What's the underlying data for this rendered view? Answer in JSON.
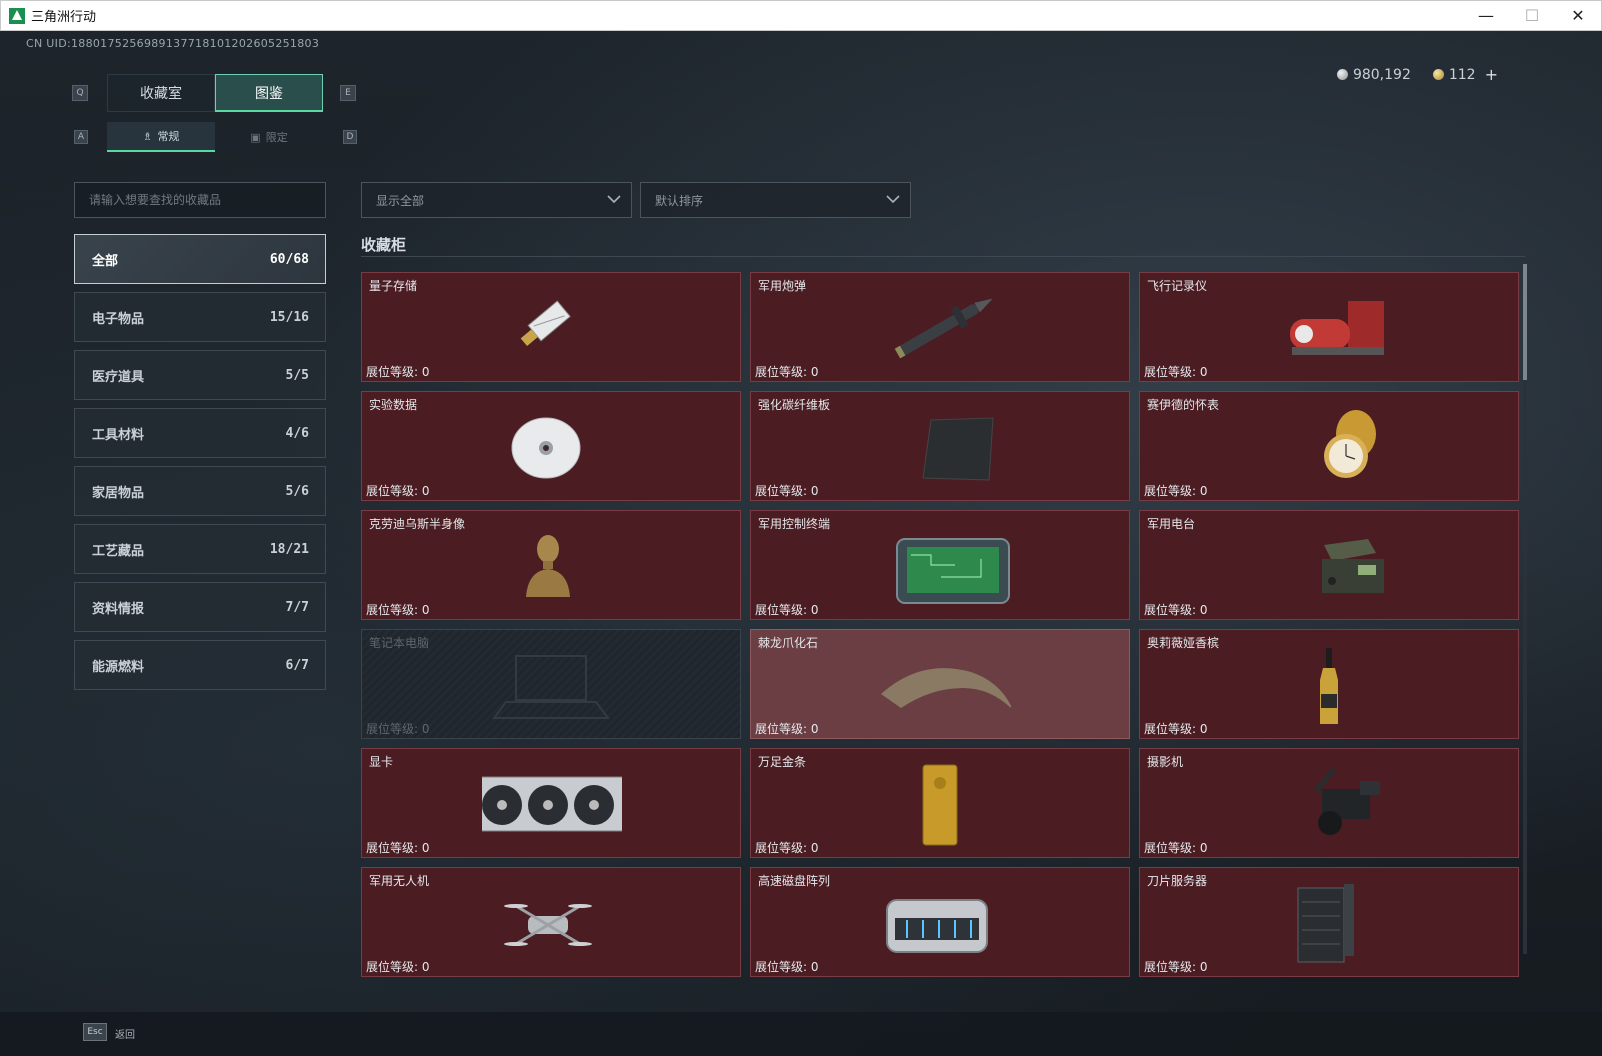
{
  "window": {
    "title": "三角洲行动",
    "minimize": "—",
    "maximize": "☐",
    "close": "✕"
  },
  "uid": "CN UID:1880175256989137718101202605251803",
  "currency": {
    "silver": "980,192",
    "gold": "112",
    "plus": "+"
  },
  "keys": {
    "q": "Q",
    "e": "E",
    "a": "A",
    "d": "D",
    "esc": "Esc"
  },
  "tabs": {
    "main": [
      "收藏室",
      "图鉴"
    ],
    "active_main": "图鉴",
    "sub": [
      "常规",
      "限定"
    ],
    "active_sub": "常规"
  },
  "search": {
    "placeholder": "请输入想要查找的收藏品"
  },
  "filters": {
    "show": "显示全部",
    "sort": "默认排序"
  },
  "categories": [
    {
      "label": "全部",
      "count": "60/68",
      "active": true
    },
    {
      "label": "电子物品",
      "count": "15/16"
    },
    {
      "label": "医疗道具",
      "count": "5/5"
    },
    {
      "label": "工具材料",
      "count": "4/6"
    },
    {
      "label": "家居物品",
      "count": "5/6"
    },
    {
      "label": "工艺藏品",
      "count": "18/21"
    },
    {
      "label": "资料情报",
      "count": "7/7"
    },
    {
      "label": "能源燃料",
      "count": "6/7"
    }
  ],
  "section_title": "收藏柜",
  "level_label": "展位等级: ",
  "items": [
    {
      "name": "量子存储",
      "level": "0"
    },
    {
      "name": "军用炮弹",
      "level": "0"
    },
    {
      "name": "飞行记录仪",
      "level": "0"
    },
    {
      "name": "实验数据",
      "level": "0"
    },
    {
      "name": "强化碳纤维板",
      "level": "0"
    },
    {
      "name": "赛伊德的怀表",
      "level": "0"
    },
    {
      "name": "克劳迪乌斯半身像",
      "level": "0"
    },
    {
      "name": "军用控制终端",
      "level": "0"
    },
    {
      "name": "军用电台",
      "level": "0"
    },
    {
      "name": "笔记本电脑",
      "level": "0"
    },
    {
      "name": "棘龙爪化石",
      "level": "0"
    },
    {
      "name": "奥莉薇娅香槟",
      "level": "0"
    },
    {
      "name": "显卡",
      "level": "0"
    },
    {
      "name": "万足金条",
      "level": "0"
    },
    {
      "name": "摄影机",
      "level": "0"
    },
    {
      "name": "军用无人机",
      "level": "0"
    },
    {
      "name": "高速磁盘阵列",
      "level": "0"
    },
    {
      "name": "刀片服务器",
      "level": "0"
    }
  ],
  "footer": {
    "back": "返回"
  }
}
